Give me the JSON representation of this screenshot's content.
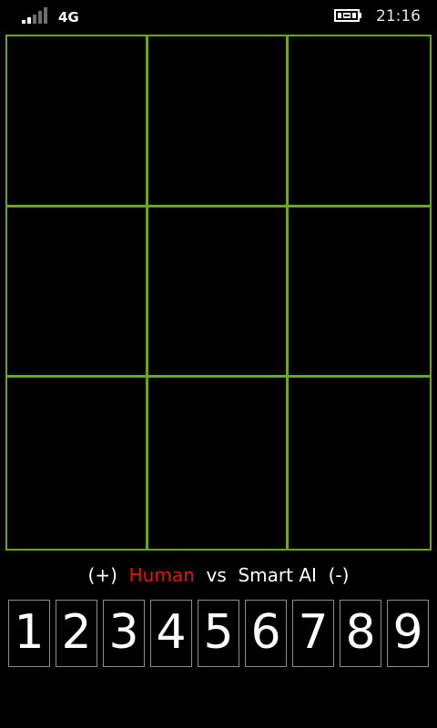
{
  "status_bar": {
    "signal_icon": "signal-strength-icon",
    "network": "4G",
    "battery_icon": "battery-charging-icon",
    "time": "21:16"
  },
  "colors": {
    "grid_line": "#6aa528",
    "human_label": "#e51400",
    "background": "#000000"
  },
  "board": {
    "cells": [
      "",
      "",
      "",
      "",
      "",
      "",
      "",
      "",
      ""
    ]
  },
  "matchup": {
    "plus": "(+)",
    "player1": "Human",
    "vs": "vs",
    "player2": "Smart AI",
    "minus": "(-)"
  },
  "keypad": {
    "digits": [
      "1",
      "2",
      "3",
      "4",
      "5",
      "6",
      "7",
      "8",
      "9"
    ]
  }
}
